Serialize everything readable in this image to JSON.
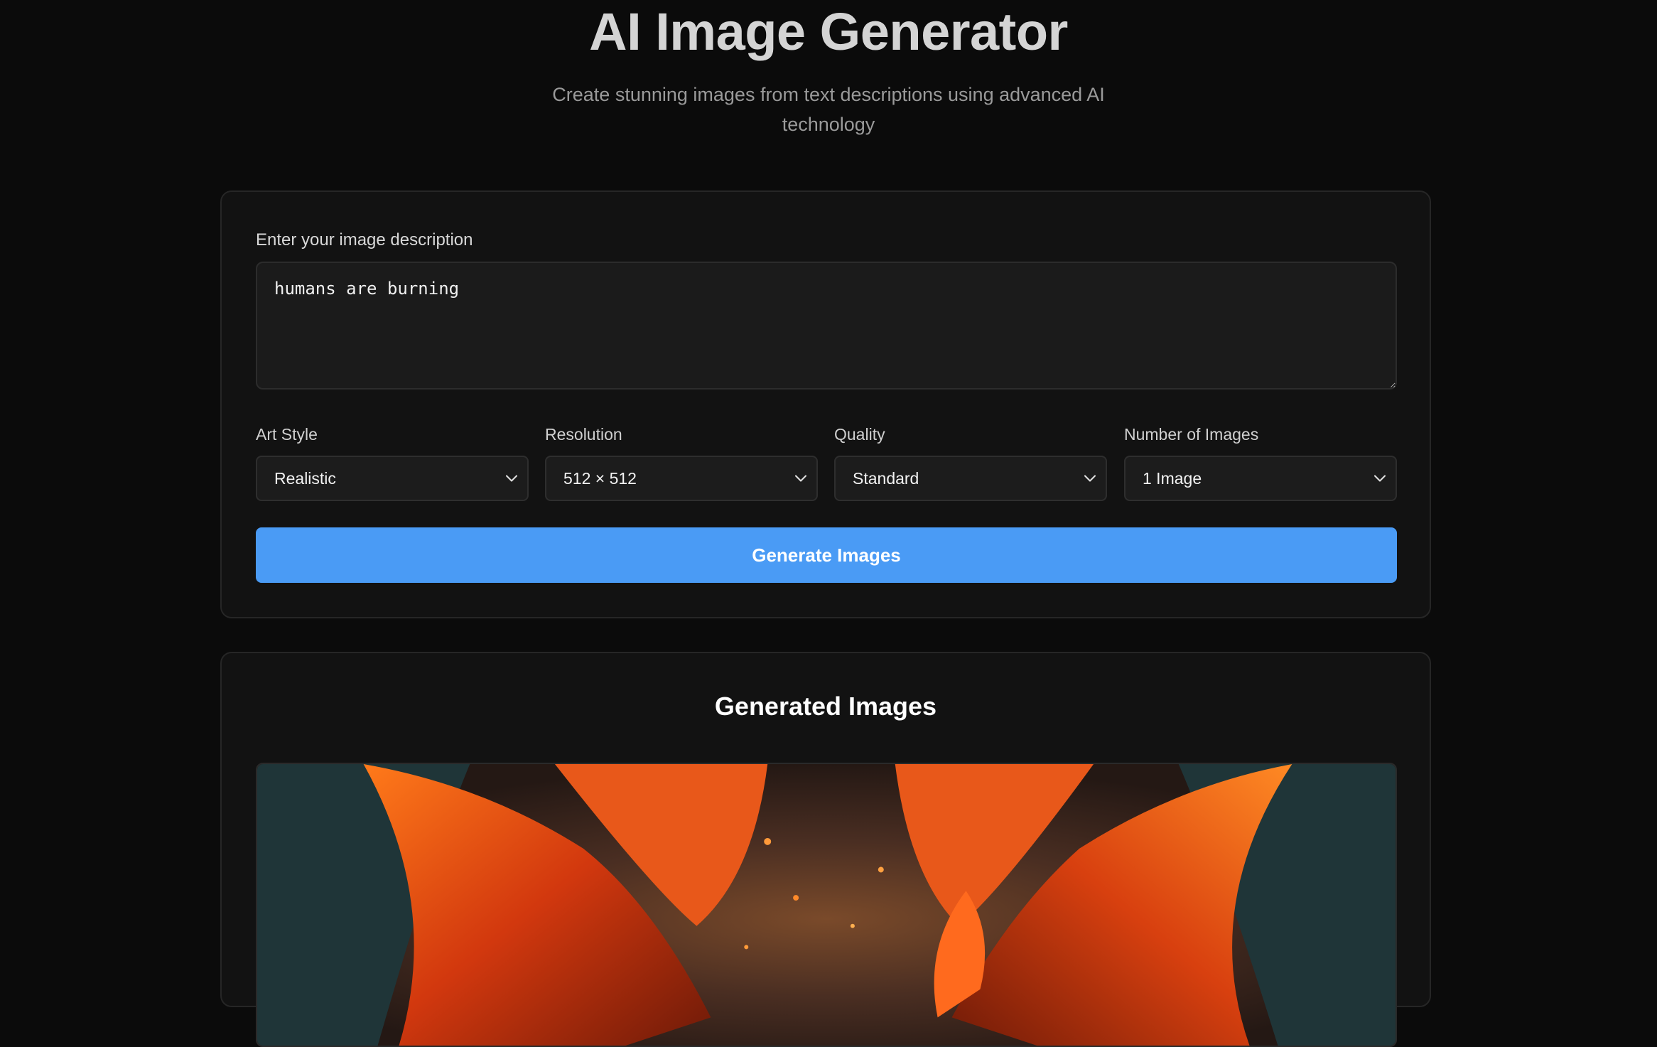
{
  "header": {
    "title": "AI Image Generator",
    "subtitle": "Create stunning images from text descriptions using advanced AI technology"
  },
  "form": {
    "prompt_label": "Enter your image description",
    "prompt_value": "humans are burning",
    "fields": [
      {
        "label": "Art Style",
        "value": "Realistic"
      },
      {
        "label": "Resolution",
        "value": "512 × 512"
      },
      {
        "label": "Quality",
        "value": "Standard"
      },
      {
        "label": "Number of Images",
        "value": "1 Image"
      }
    ],
    "generate_label": "Generate Images"
  },
  "results": {
    "title": "Generated Images"
  },
  "colors": {
    "accent": "#4a9bf5",
    "background": "#0b0b0b",
    "card": "#121212"
  },
  "icons": {
    "select_chevron": "chevron-down-icon"
  }
}
